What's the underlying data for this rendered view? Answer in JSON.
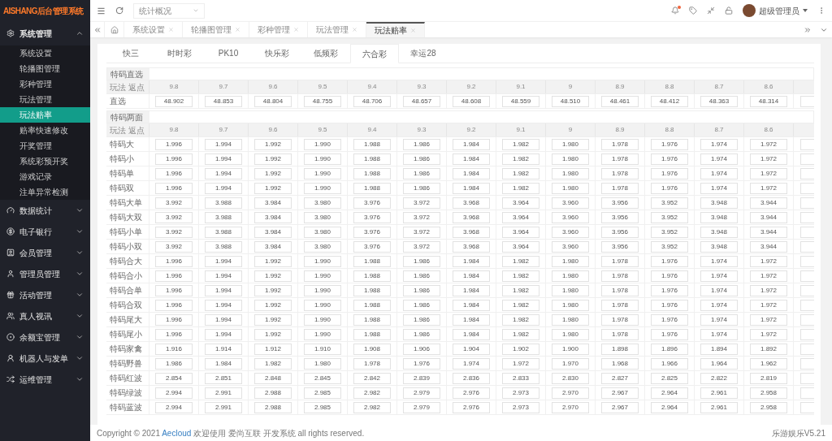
{
  "sidebar": {
    "logo": "AISHANG后台管理系统",
    "groups": [
      {
        "label": "系统管理",
        "expanded": true,
        "children": [
          {
            "label": "系统设置",
            "selected": false
          },
          {
            "label": "轮播图管理",
            "selected": false
          },
          {
            "label": "彩种管理",
            "selected": false
          },
          {
            "label": "玩法管理",
            "selected": false
          },
          {
            "label": "玩法赔率",
            "selected": true
          },
          {
            "label": "赔率快速修改",
            "selected": false
          },
          {
            "label": "开奖管理",
            "selected": false
          },
          {
            "label": "系统彩预开奖",
            "selected": false
          },
          {
            "label": "游戏记录",
            "selected": false
          },
          {
            "label": "注单异常检测",
            "selected": false
          }
        ]
      },
      {
        "label": "数据统计",
        "expanded": false
      },
      {
        "label": "电子银行",
        "expanded": false
      },
      {
        "label": "会员管理",
        "expanded": false
      },
      {
        "label": "管理员管理",
        "expanded": false
      },
      {
        "label": "活动管理",
        "expanded": false
      },
      {
        "label": "真人视讯",
        "expanded": false
      },
      {
        "label": "余额宝管理",
        "expanded": false
      },
      {
        "label": "机器人与发单",
        "expanded": false
      },
      {
        "label": "运维管理",
        "expanded": false
      }
    ]
  },
  "topbar": {
    "select": "统计概况",
    "notification": true,
    "user": "超级管理员"
  },
  "page_tabs": [
    {
      "label": "系统设置",
      "selected": false
    },
    {
      "label": "轮播图管理",
      "selected": false
    },
    {
      "label": "彩种管理",
      "selected": false
    },
    {
      "label": "玩法管理",
      "selected": false
    },
    {
      "label": "玩法赔率",
      "selected": true
    }
  ],
  "lottery_tabs": [
    {
      "label": "快三",
      "selected": false
    },
    {
      "label": "时时彩",
      "selected": false
    },
    {
      "label": "PK10",
      "selected": false
    },
    {
      "label": "快乐彩",
      "selected": false
    },
    {
      "label": "低频彩",
      "selected": false
    },
    {
      "label": "六合彩",
      "selected": true
    },
    {
      "label": "幸运28",
      "selected": false
    }
  ],
  "sections": [
    {
      "title": "特码直选",
      "header_label": "玩法 返点",
      "rates": [
        "9.8",
        "9.7",
        "9.6",
        "9.5",
        "9.4",
        "9.3",
        "9.2",
        "9.1",
        "9",
        "8.9",
        "8.8",
        "8.7",
        "8.6"
      ],
      "rows": [
        {
          "label": "直选",
          "values": [
            "48.902",
            "48.853",
            "48.804",
            "48.755",
            "48.706",
            "48.657",
            "48.608",
            "48.559",
            "48.510",
            "48.461",
            "48.412",
            "48.363",
            "48.314"
          ]
        }
      ]
    },
    {
      "title": "特码两面",
      "header_label": "玩法 返点",
      "rates": [
        "9.8",
        "9.7",
        "9.6",
        "9.5",
        "9.4",
        "9.3",
        "9.2",
        "9.1",
        "9",
        "8.9",
        "8.8",
        "8.7",
        "8.6"
      ],
      "rows": [
        {
          "label": "特码大",
          "values": [
            "1.996",
            "1.994",
            "1.992",
            "1.990",
            "1.988",
            "1.986",
            "1.984",
            "1.982",
            "1.980",
            "1.978",
            "1.976",
            "1.974",
            "1.972"
          ]
        },
        {
          "label": "特码小",
          "values": [
            "1.996",
            "1.994",
            "1.992",
            "1.990",
            "1.988",
            "1.986",
            "1.984",
            "1.982",
            "1.980",
            "1.978",
            "1.976",
            "1.974",
            "1.972"
          ]
        },
        {
          "label": "特码单",
          "values": [
            "1.996",
            "1.994",
            "1.992",
            "1.990",
            "1.988",
            "1.986",
            "1.984",
            "1.982",
            "1.980",
            "1.978",
            "1.976",
            "1.974",
            "1.972"
          ]
        },
        {
          "label": "特码双",
          "values": [
            "1.996",
            "1.994",
            "1.992",
            "1.990",
            "1.988",
            "1.986",
            "1.984",
            "1.982",
            "1.980",
            "1.978",
            "1.976",
            "1.974",
            "1.972"
          ]
        },
        {
          "label": "特码大单",
          "values": [
            "3.992",
            "3.988",
            "3.984",
            "3.980",
            "3.976",
            "3.972",
            "3.968",
            "3.964",
            "3.960",
            "3.956",
            "3.952",
            "3.948",
            "3.944"
          ]
        },
        {
          "label": "特码大双",
          "values": [
            "3.992",
            "3.988",
            "3.984",
            "3.980",
            "3.976",
            "3.972",
            "3.968",
            "3.964",
            "3.960",
            "3.956",
            "3.952",
            "3.948",
            "3.944"
          ]
        },
        {
          "label": "特码小单",
          "values": [
            "3.992",
            "3.988",
            "3.984",
            "3.980",
            "3.976",
            "3.972",
            "3.968",
            "3.964",
            "3.960",
            "3.956",
            "3.952",
            "3.948",
            "3.944"
          ]
        },
        {
          "label": "特码小双",
          "values": [
            "3.992",
            "3.988",
            "3.984",
            "3.980",
            "3.976",
            "3.972",
            "3.968",
            "3.964",
            "3.960",
            "3.956",
            "3.952",
            "3.948",
            "3.944"
          ]
        },
        {
          "label": "特码合大",
          "values": [
            "1.996",
            "1.994",
            "1.992",
            "1.990",
            "1.988",
            "1.986",
            "1.984",
            "1.982",
            "1.980",
            "1.978",
            "1.976",
            "1.974",
            "1.972"
          ]
        },
        {
          "label": "特码合小",
          "values": [
            "1.996",
            "1.994",
            "1.992",
            "1.990",
            "1.988",
            "1.986",
            "1.984",
            "1.982",
            "1.980",
            "1.978",
            "1.976",
            "1.974",
            "1.972"
          ]
        },
        {
          "label": "特码合单",
          "values": [
            "1.996",
            "1.994",
            "1.992",
            "1.990",
            "1.988",
            "1.986",
            "1.984",
            "1.982",
            "1.980",
            "1.978",
            "1.976",
            "1.974",
            "1.972"
          ]
        },
        {
          "label": "特码合双",
          "values": [
            "1.996",
            "1.994",
            "1.992",
            "1.990",
            "1.988",
            "1.986",
            "1.984",
            "1.982",
            "1.980",
            "1.978",
            "1.976",
            "1.974",
            "1.972"
          ]
        },
        {
          "label": "特码尾大",
          "values": [
            "1.996",
            "1.994",
            "1.992",
            "1.990",
            "1.988",
            "1.986",
            "1.984",
            "1.982",
            "1.980",
            "1.978",
            "1.976",
            "1.974",
            "1.972"
          ]
        },
        {
          "label": "特码尾小",
          "values": [
            "1.996",
            "1.994",
            "1.992",
            "1.990",
            "1.988",
            "1.986",
            "1.984",
            "1.982",
            "1.980",
            "1.978",
            "1.976",
            "1.974",
            "1.972"
          ]
        },
        {
          "label": "特码家禽",
          "values": [
            "1.916",
            "1.914",
            "1.912",
            "1.910",
            "1.908",
            "1.906",
            "1.904",
            "1.902",
            "1.900",
            "1.898",
            "1.896",
            "1.894",
            "1.892"
          ]
        },
        {
          "label": "特码野兽",
          "values": [
            "1.986",
            "1.984",
            "1.982",
            "1.980",
            "1.978",
            "1.976",
            "1.974",
            "1.972",
            "1.970",
            "1.968",
            "1.966",
            "1.964",
            "1.962"
          ]
        },
        {
          "label": "特码红波",
          "values": [
            "2.854",
            "2.851",
            "2.848",
            "2.845",
            "2.842",
            "2.839",
            "2.836",
            "2.833",
            "2.830",
            "2.827",
            "2.825",
            "2.822",
            "2.819"
          ]
        },
        {
          "label": "特码绿波",
          "values": [
            "2.994",
            "2.991",
            "2.988",
            "2.985",
            "2.982",
            "2.979",
            "2.976",
            "2.973",
            "2.970",
            "2.967",
            "2.964",
            "2.961",
            "2.958"
          ]
        },
        {
          "label": "特码蓝波",
          "values": [
            "2.994",
            "2.991",
            "2.988",
            "2.985",
            "2.982",
            "2.979",
            "2.976",
            "2.973",
            "2.970",
            "2.967",
            "2.964",
            "2.961",
            "2.958"
          ]
        }
      ]
    }
  ],
  "footer": {
    "copyright_start": "Copyright © 2021",
    "link": "Aecloud",
    "copyright_end": "欢迎使用 爱尚互联 开发系统 all rights reserved.",
    "version": "乐游娱乐V5.21"
  }
}
